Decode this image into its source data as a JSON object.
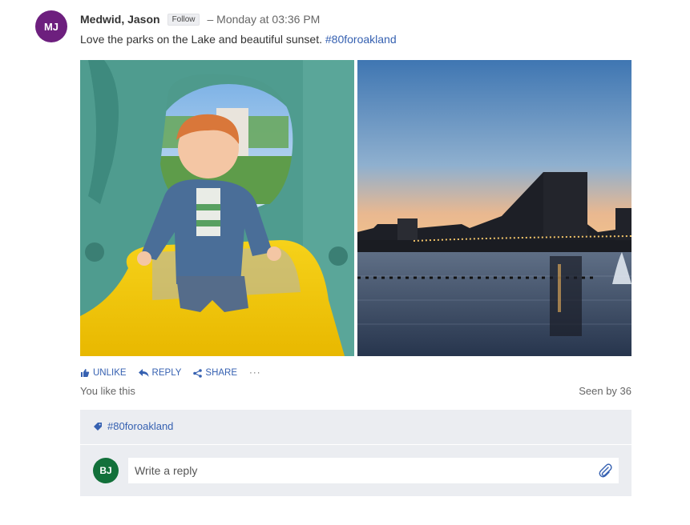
{
  "post": {
    "author": {
      "name": "Medwid, Jason",
      "initials": "MJ",
      "avatar_color": "#6d1f7e",
      "follow_label": "Follow"
    },
    "timestamp": "– Monday at 03:36 PM",
    "text": "Love the parks on the Lake and beautiful sunset.",
    "hashtag": "#80foroakland",
    "images": [
      "photo-child-on-yellow-slide",
      "photo-lake-merritt-sunset-skyline"
    ]
  },
  "actions": {
    "unlike": "UNLIKE",
    "reply": "REPLY",
    "share": "SHARE",
    "more": "···"
  },
  "likes_summary": "You like this",
  "seen_by": "Seen by 36",
  "topics": [
    "#80foroakland"
  ],
  "reply": {
    "user_initials": "BJ",
    "avatar_color": "#12703a",
    "placeholder": "Write a reply"
  },
  "colors": {
    "link": "#3661b1",
    "panel": "#ebedf1"
  }
}
